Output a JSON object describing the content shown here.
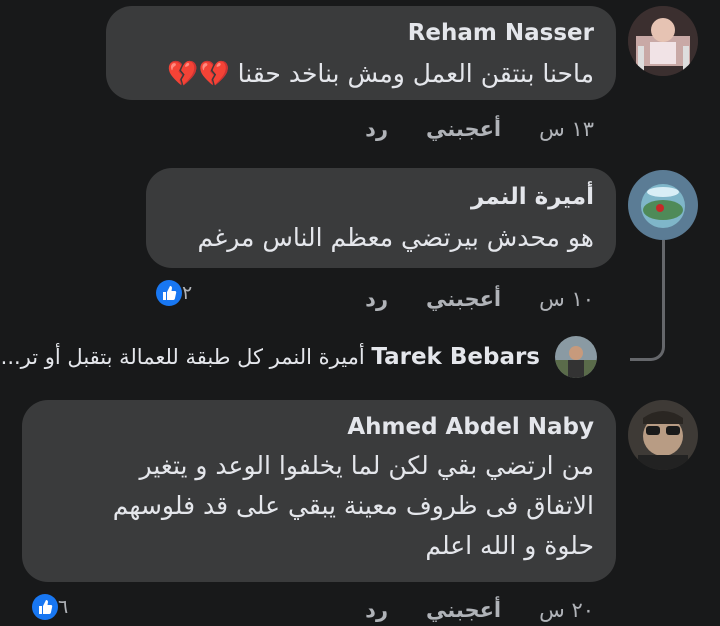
{
  "comments": [
    {
      "author": "Reham Nasser",
      "text_line1": "ماحنا بنتقن العمل ومش بناخد حقنا",
      "emoji": "💔💔",
      "time": "١٣ س",
      "like_label": "أعجبني",
      "reply_label": "رد"
    },
    {
      "author": "أميرة النمر",
      "text_line1": "هو محدش بيرتضي معظم الناس مرغم",
      "time": "١٠ س",
      "like_label": "أعجبني",
      "reply_label": "رد",
      "reaction_count": "٢"
    },
    {
      "author": "Ahmed Abdel Naby",
      "text_line1": "من ارتضي بقي لكن لما يخلفوا الوعد و يتغير",
      "text_line2": "الاتفاق فى ظروف معينة يبقي على قد فلوسهم",
      "text_line3": "حلوة و الله اعلم",
      "time": "٢٠ س",
      "like_label": "أعجبني",
      "reply_label": "رد",
      "reaction_count": "٦"
    }
  ],
  "reply_preview": {
    "author": "Tarek Bebars",
    "text": "أميرة النمر كل طبقة للعمالة بتقبل أو تر..."
  },
  "colors": {
    "background": "#18191a",
    "bubble": "#3a3b3c",
    "text": "#e4e6eb",
    "secondary": "#b0b3b8",
    "like_blue": "#1877f2"
  }
}
